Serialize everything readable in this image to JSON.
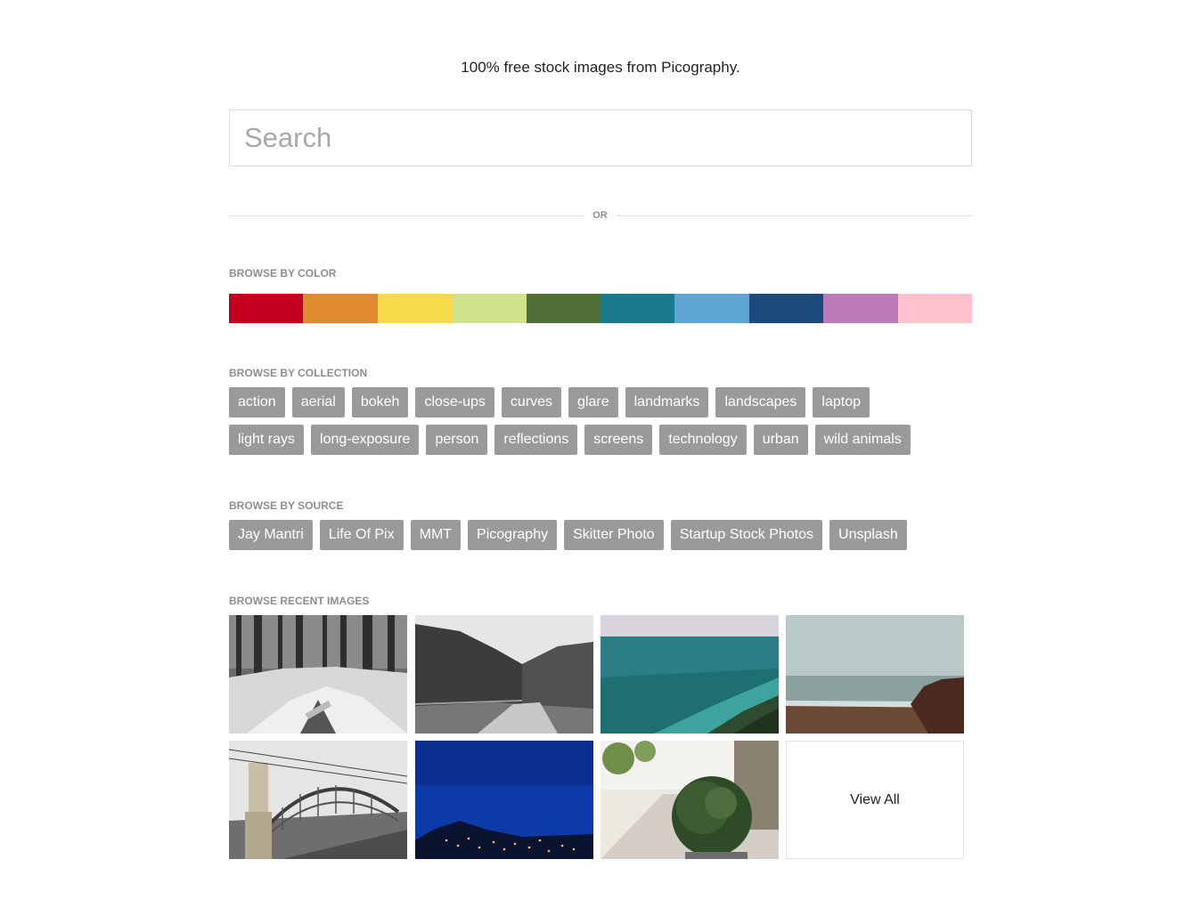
{
  "tagline": "100% free stock images from Picography.",
  "search": {
    "placeholder": "Search",
    "value": ""
  },
  "divider": {
    "label": "OR"
  },
  "color_section": {
    "label": "BROWSE BY COLOR",
    "swatches": [
      {
        "name": "red",
        "color": "#c20020"
      },
      {
        "name": "orange",
        "color": "#e08a32"
      },
      {
        "name": "yellow",
        "color": "#f6da48"
      },
      {
        "name": "light-green",
        "color": "#cfe48a"
      },
      {
        "name": "dark-green",
        "color": "#507037"
      },
      {
        "name": "teal",
        "color": "#197a8e"
      },
      {
        "name": "light-blue",
        "color": "#5fa6d5"
      },
      {
        "name": "navy",
        "color": "#1b4a7b"
      },
      {
        "name": "purple",
        "color": "#bd7ab8"
      },
      {
        "name": "pink",
        "color": "#fec2cf"
      }
    ]
  },
  "collection_section": {
    "label": "BROWSE BY COLLECTION",
    "tags": [
      "action",
      "aerial",
      "bokeh",
      "close-ups",
      "curves",
      "glare",
      "landmarks",
      "landscapes",
      "laptop",
      "light rays",
      "long-exposure",
      "person",
      "reflections",
      "screens",
      "technology",
      "urban",
      "wild animals"
    ]
  },
  "source_section": {
    "label": "BROWSE BY SOURCE",
    "tags": [
      "Jay Mantri",
      "Life Of Pix",
      "MMT",
      "Picography",
      "Skitter Photo",
      "Startup Stock Photos",
      "Unsplash"
    ]
  },
  "recent_section": {
    "label": "BROWSE RECENT IMAGES",
    "images": [
      {
        "subject": "snowy-forest-creek"
      },
      {
        "subject": "mountain-valley-road"
      },
      {
        "subject": "turquoise-ocean-coast"
      },
      {
        "subject": "misty-beach-cliff"
      },
      {
        "subject": "arched-bridge"
      },
      {
        "subject": "night-town-hills"
      },
      {
        "subject": "round-shrub-sidewalk"
      }
    ],
    "view_all_label": "View All"
  }
}
